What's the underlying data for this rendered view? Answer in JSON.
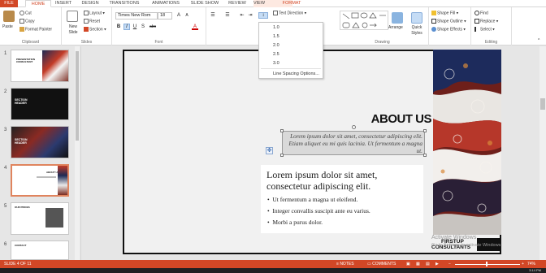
{
  "tabs": [
    "FILE",
    "HOME",
    "INSERT",
    "DESIGN",
    "TRANSITIONS",
    "ANIMATIONS",
    "SLIDE SHOW",
    "REVIEW",
    "VIEW",
    "FORMAT"
  ],
  "ribbon": {
    "clipboard": {
      "paste": "Paste",
      "cut": "Cut",
      "copy": "Copy",
      "format_painter": "Format Painter",
      "label": "Clipboard"
    },
    "slides": {
      "new_slide": "New Slide",
      "layout": "Layout",
      "reset": "Reset",
      "section": "Section",
      "label": "Slides"
    },
    "font": {
      "name": "Times New Rom",
      "size": "18",
      "bold": "B",
      "italic": "I",
      "underline": "U",
      "shadow": "S",
      "strike": "abc",
      "color": "A",
      "label": "Font"
    },
    "paragraph": {
      "text_direction": "Text Direction"
    },
    "drawing": {
      "arrange": "Arrange",
      "quick_styles": "Quick Styles",
      "shape_fill": "Shape Fill",
      "shape_outline": "Shape Outline",
      "shape_effects": "Shape Effects",
      "label": "Drawing"
    },
    "editing": {
      "find": "Find",
      "replace": "Replace",
      "select": "Select",
      "label": "Editing"
    }
  },
  "line_spacing_menu": {
    "options": [
      "1.0",
      "1.5",
      "2.0",
      "2.5",
      "3.0"
    ],
    "more": "Line Spacing Options..."
  },
  "thumbnails": [
    {
      "num": "1",
      "title": "PRESENTATION CONSULTANT"
    },
    {
      "num": "2",
      "title": "SECTION HEADER"
    },
    {
      "num": "3",
      "title": "SECTION HEADER"
    },
    {
      "num": "4",
      "title": "ABOUT US"
    },
    {
      "num": "5",
      "title": "OUR PRICES"
    },
    {
      "num": "6",
      "title": "CONTACT"
    }
  ],
  "slide": {
    "heading": "ABOUT US",
    "italic_text": "Lorem ipsum dolor sit amet, consectetur adipiscing elit. Etiam aliquet eu mi quis lacinia. Ut fermentum a magna ut.",
    "body_title": "Lorem ipsum dolor sit amet, consectetur adipiscing elit.",
    "bullets": [
      "Ut fermentum a magna ut eleifend.",
      "Integer convallis suscipit ante eu varius.",
      "Morbi a purus dolor."
    ],
    "logo_line1": "FIRSTUP",
    "logo_line2": "CONSULTANTS",
    "watermark_1": "Activate Windows",
    "watermark_2": "Go to Settings to activate Windows."
  },
  "status": {
    "slide_of": "SLIDE 4 OF 11",
    "notes": "NOTES",
    "comments": "COMMENTS",
    "zoom": "74%",
    "time": "3:14 PM"
  },
  "colors": {
    "accent": "#d24726",
    "selection": "#e0845e"
  }
}
